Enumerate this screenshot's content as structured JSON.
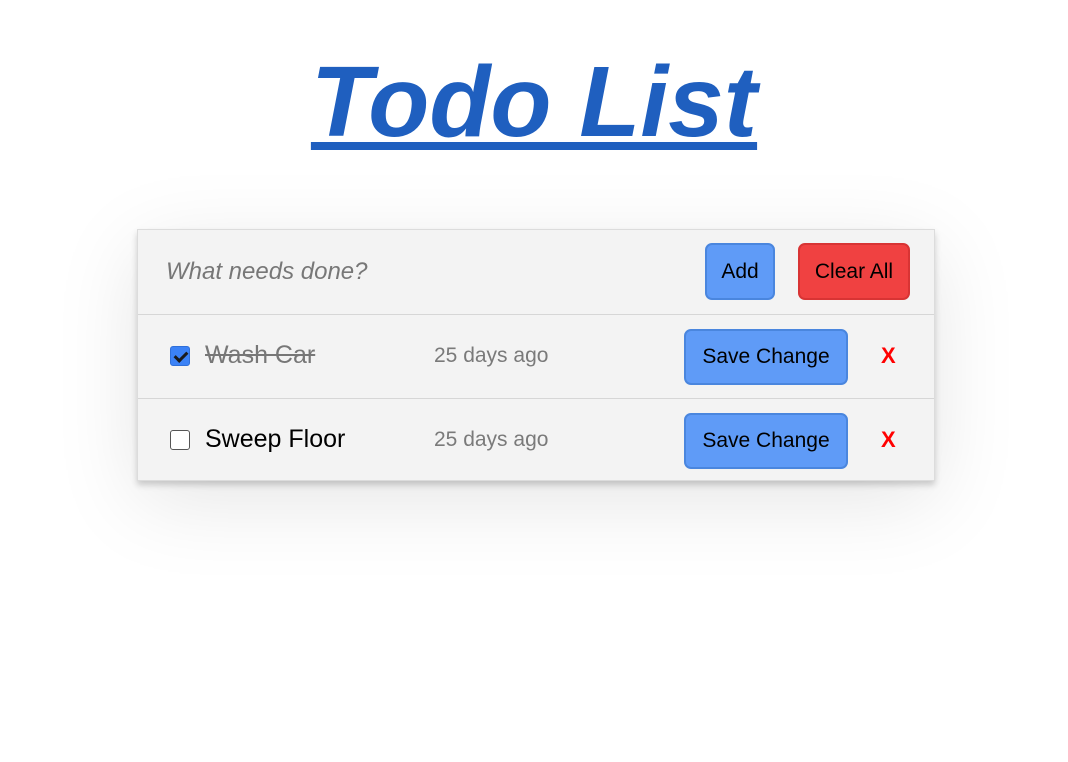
{
  "page": {
    "title": "Todo List",
    "title_color": "#1f5fbf"
  },
  "form": {
    "input_placeholder": "What needs done?",
    "input_value": "",
    "add_label": "Add",
    "clear_label": "Clear All",
    "add_color": "#5f9bf7",
    "clear_color": "#f04141"
  },
  "todos": [
    {
      "text": "Wash Car",
      "completed": true,
      "timestamp": "25 days ago",
      "save_label": "Save Change",
      "delete_label": "X"
    },
    {
      "text": "Sweep Floor",
      "completed": false,
      "timestamp": "25 days ago",
      "save_label": "Save Change",
      "delete_label": "X"
    }
  ]
}
